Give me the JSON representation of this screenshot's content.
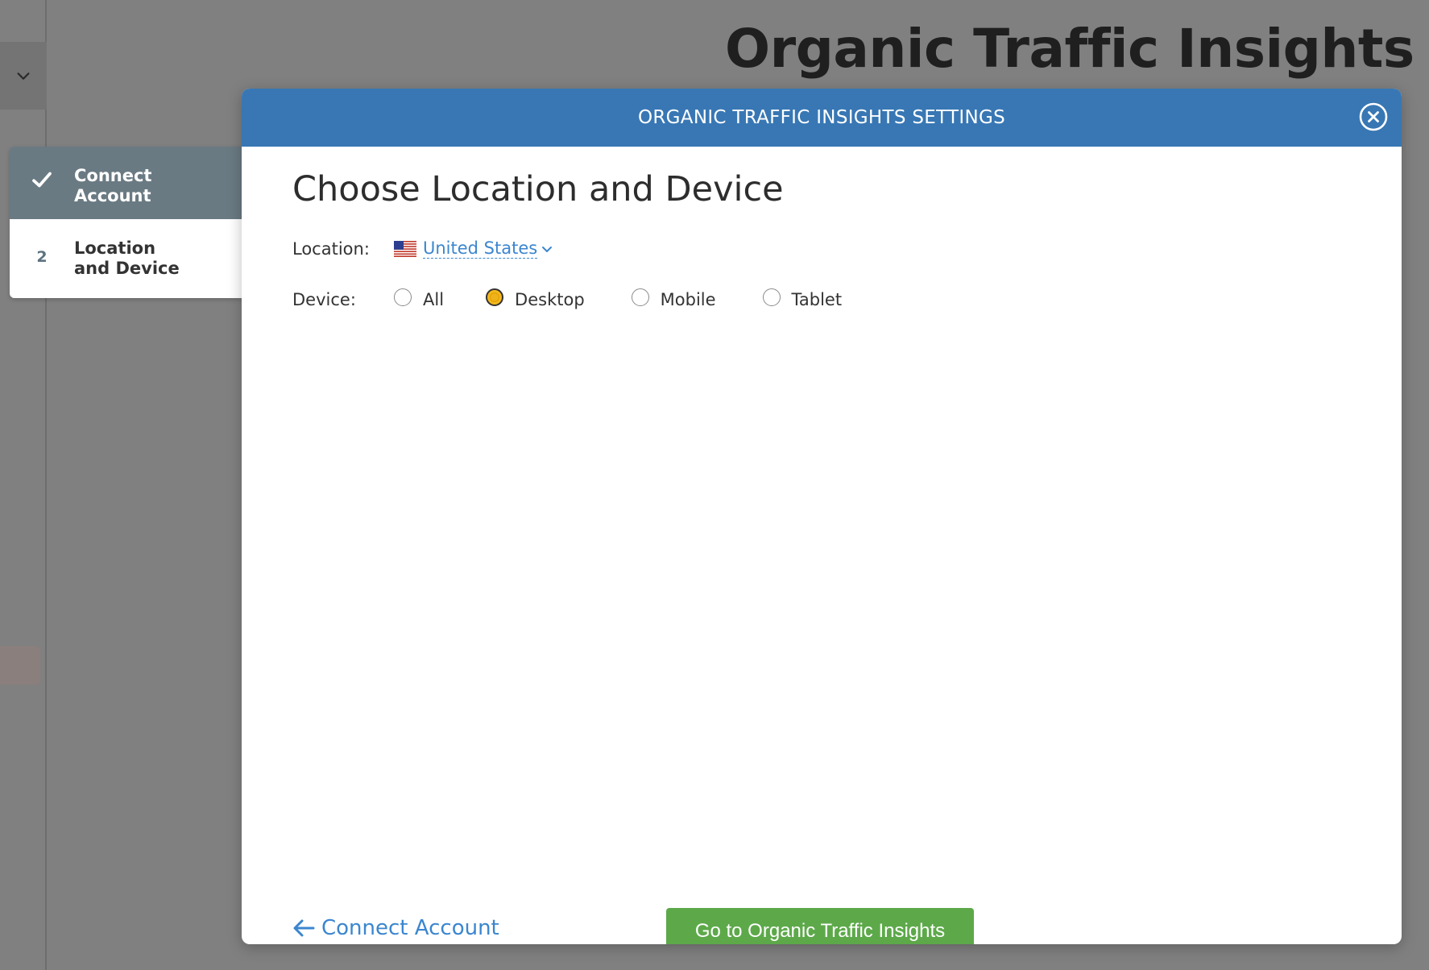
{
  "background": {
    "page_title": "Organic Traffic Insights"
  },
  "stepper": {
    "steps": [
      {
        "label": "Connect Account",
        "state": "done",
        "icon": "check-icon"
      },
      {
        "number": "2",
        "label": "Location and Device",
        "state": "active"
      }
    ]
  },
  "modal": {
    "title": "ORGANIC TRAFFIC INSIGHTS SETTINGS",
    "heading": "Choose Location and Device",
    "location": {
      "label": "Location:",
      "value": "United States",
      "flag_icon": "us-flag-icon"
    },
    "device": {
      "label": "Device:",
      "options": [
        "All",
        "Desktop",
        "Mobile",
        "Tablet"
      ],
      "selected": "Desktop"
    },
    "back_link": "Connect Account",
    "primary_button": "Go to Organic Traffic Insights"
  },
  "colors": {
    "header_blue": "#3877b4",
    "link_blue": "#3b86cf",
    "primary_green": "#5da94a",
    "radio_selected": "#f0b21a",
    "step_done_bg": "#6a7a83",
    "overlay": "#808080"
  }
}
